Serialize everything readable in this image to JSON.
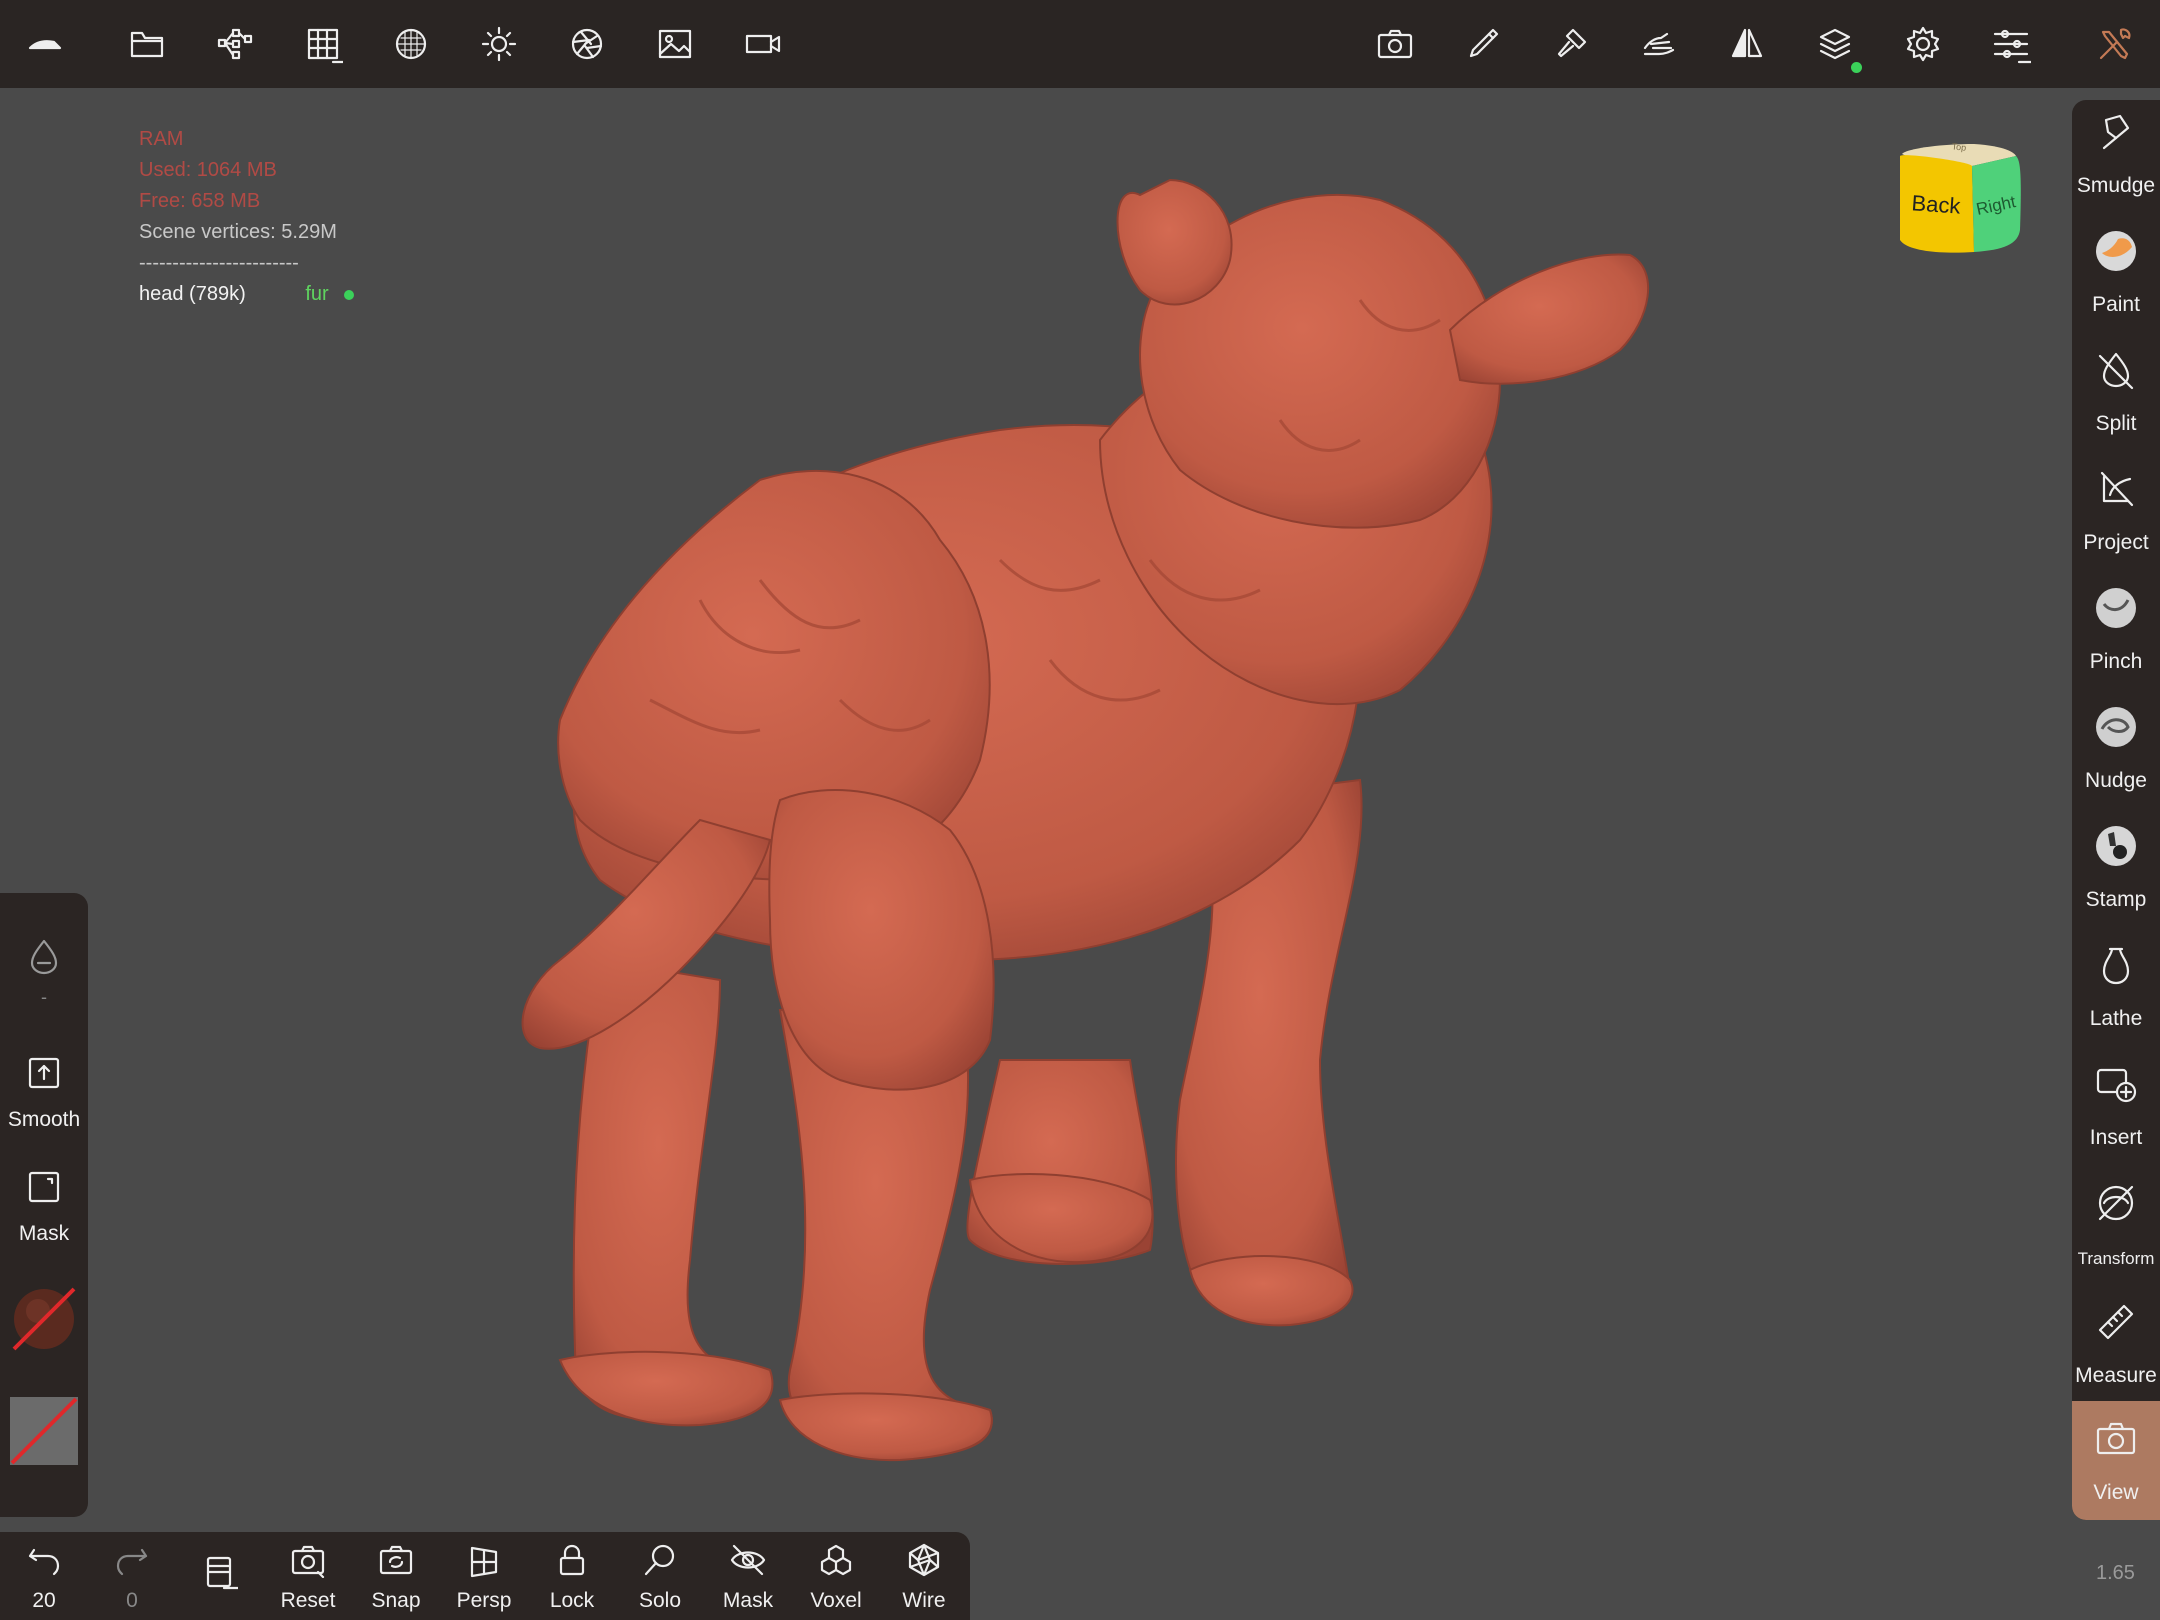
{
  "topbar": {
    "icons": [
      "app-logo-icon",
      "folder-icon",
      "scene-tree-icon",
      "grid-icon",
      "matcap-sphere-icon",
      "lighting-sun-icon",
      "aperture-icon",
      "image-icon",
      "video-camera-icon",
      "screenshot-camera-icon",
      "brush-stroke-icon",
      "paint-brush-icon",
      "hand-sculpt-icon",
      "symmetry-icon",
      "layers-icon",
      "settings-gear-icon",
      "sliders-icon",
      "tools-icon"
    ]
  },
  "stats": {
    "ram_label": "RAM",
    "used": "Used: 1064 MB",
    "free": "Free: 658 MB",
    "vertices": "Scene vertices: 5.29M",
    "separator": "------------------------",
    "mesh_name": "head (789k)",
    "mesh_material": "fur"
  },
  "view_cube": {
    "front": "Back",
    "side": "Right",
    "top": "Top",
    "colors": {
      "front": "#f3c600",
      "side": "#4fd17a",
      "top": "#e9dcb6"
    }
  },
  "right_tools": [
    {
      "label": "Smudge",
      "icon": "smudge-icon"
    },
    {
      "label": "Paint",
      "icon": "paint-sphere-icon"
    },
    {
      "label": "Split",
      "icon": "split-icon"
    },
    {
      "label": "Project",
      "icon": "project-icon"
    },
    {
      "label": "Pinch",
      "icon": "pinch-sphere-icon"
    },
    {
      "label": "Nudge",
      "icon": "nudge-sphere-icon"
    },
    {
      "label": "Stamp",
      "icon": "stamp-sphere-icon"
    },
    {
      "label": "Lathe",
      "icon": "lathe-icon"
    },
    {
      "label": "Insert",
      "icon": "insert-icon"
    },
    {
      "label": "Transform",
      "icon": "transform-icon"
    },
    {
      "label": "Measure",
      "icon": "ruler-icon"
    },
    {
      "label": "View",
      "icon": "view-camera-icon"
    }
  ],
  "left_tools": {
    "opacity_value": "-",
    "smooth_label": "Smooth",
    "mask_label": "Mask"
  },
  "bottom_tools": {
    "undo_count": "20",
    "redo_count": "0",
    "items": [
      {
        "label": "Reset"
      },
      {
        "label": "Snap"
      },
      {
        "label": "Persp"
      },
      {
        "label": "Lock"
      },
      {
        "label": "Solo"
      },
      {
        "label": "Mask"
      },
      {
        "label": "Voxel"
      },
      {
        "label": "Wire"
      }
    ]
  },
  "zoom_level": "1.65",
  "colors": {
    "accent": "#ad7a61",
    "model": "#c25a45",
    "background": "#4a4a4a",
    "panel": "#2b2523"
  }
}
